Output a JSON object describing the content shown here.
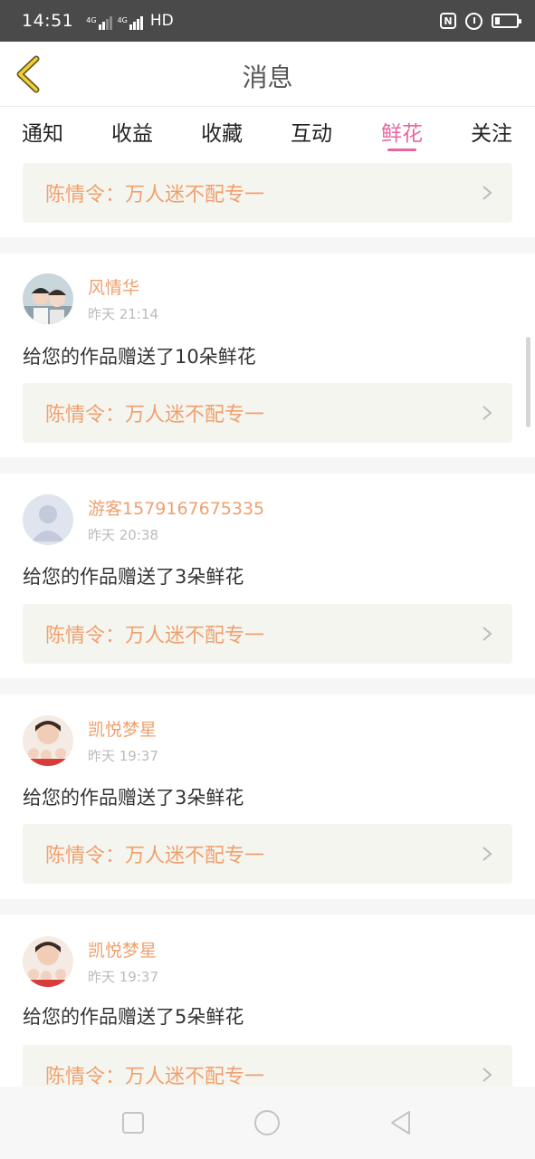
{
  "status": {
    "time": "14:51",
    "net1": "4G",
    "net2": "4G",
    "hd": "HD"
  },
  "header": {
    "title": "消息"
  },
  "tabs": [
    {
      "label": "通知"
    },
    {
      "label": "收益"
    },
    {
      "label": "收藏"
    },
    {
      "label": "互动"
    },
    {
      "label": "鲜花",
      "active": true
    },
    {
      "label": "关注"
    }
  ],
  "items": [
    {
      "work": "陈情令：万人迷不配专一"
    },
    {
      "user": "风情华",
      "time": "昨天 21:14",
      "message": "给您的作品赠送了10朵鲜花",
      "work": "陈情令：万人迷不配专一",
      "avatar": "photo-avatar"
    },
    {
      "user": "游客1579167675335",
      "time": "昨天 20:38",
      "message": "给您的作品赠送了3朵鲜花",
      "work": "陈情令：万人迷不配专一",
      "avatar": "default-avatar"
    },
    {
      "user": "凯悦梦星",
      "time": "昨天 19:37",
      "message": "给您的作品赠送了3朵鲜花",
      "work": "陈情令：万人迷不配专一",
      "avatar": "photo-avatar"
    },
    {
      "user": "凯悦梦星",
      "time": "昨天 19:37",
      "message": "给您的作品赠送了5朵鲜花",
      "work": "陈情令：万人迷不配专一",
      "avatar": "photo-avatar"
    }
  ],
  "colors": {
    "accent": "#e866a0",
    "username": "#f0a06e",
    "card_bg": "#f5f5ef"
  }
}
